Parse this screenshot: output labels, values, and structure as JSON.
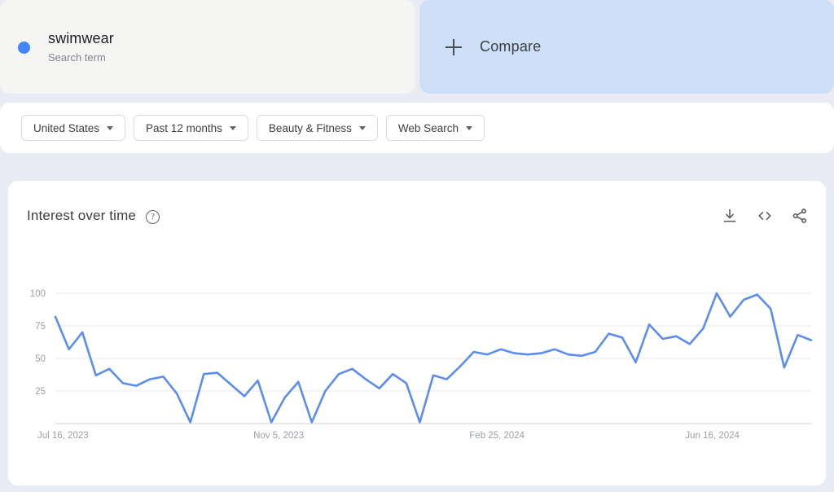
{
  "search_card": {
    "term": "swimwear",
    "subtitle": "Search term",
    "dot_color": "#4285F4"
  },
  "compare_card": {
    "label": "Compare",
    "icon": "plus-icon",
    "bg_color": "#CEDFF8"
  },
  "filters": [
    {
      "label": "United States",
      "icon": "chevron-down-icon"
    },
    {
      "label": "Past 12 months",
      "icon": "chevron-down-icon"
    },
    {
      "label": "Beauty & Fitness",
      "icon": "chevron-down-icon"
    },
    {
      "label": "Web Search",
      "icon": "chevron-down-icon"
    }
  ],
  "chart_panel": {
    "title": "Interest over time",
    "help_icon": "help-circle-icon",
    "help_glyph": "?",
    "actions": [
      {
        "name": "download-icon",
        "label": "Download"
      },
      {
        "name": "embed-code-icon",
        "label": "Embed"
      },
      {
        "name": "share-icon",
        "label": "Share"
      }
    ]
  },
  "chart_data": {
    "type": "line",
    "title": "Interest over time",
    "xlabel": "",
    "ylabel": "",
    "ylim": [
      0,
      100
    ],
    "yticks": [
      25,
      50,
      75,
      100
    ],
    "grid": true,
    "legend": "none",
    "line_color": "#5B8DEF",
    "xtick_labels": [
      "Jul 16, 2023",
      "Nov 5, 2023",
      "Feb 25, 2024",
      "Jun 16, 2024"
    ],
    "xtick_indices": [
      0,
      16,
      32,
      48
    ],
    "x": [
      "Jul 16, 2023",
      "Jul 23, 2023",
      "Jul 30, 2023",
      "Aug 6, 2023",
      "Aug 13, 2023",
      "Aug 20, 2023",
      "Aug 27, 2023",
      "Sep 3, 2023",
      "Sep 10, 2023",
      "Sep 17, 2023",
      "Sep 24, 2023",
      "Oct 1, 2023",
      "Oct 8, 2023",
      "Oct 15, 2023",
      "Oct 22, 2023",
      "Oct 29, 2023",
      "Nov 5, 2023",
      "Nov 12, 2023",
      "Nov 19, 2023",
      "Nov 26, 2023",
      "Dec 3, 2023",
      "Dec 10, 2023",
      "Dec 17, 2023",
      "Dec 24, 2023",
      "Dec 31, 2023",
      "Jan 7, 2024",
      "Jan 14, 2024",
      "Jan 21, 2024",
      "Jan 28, 2024",
      "Feb 4, 2024",
      "Feb 11, 2024",
      "Feb 18, 2024",
      "Feb 25, 2024",
      "Mar 3, 2024",
      "Mar 10, 2024",
      "Mar 17, 2024",
      "Mar 24, 2024",
      "Mar 31, 2024",
      "Apr 7, 2024",
      "Apr 14, 2024",
      "Apr 21, 2024",
      "Apr 28, 2024",
      "May 5, 2024",
      "May 12, 2024",
      "May 19, 2024",
      "May 26, 2024",
      "Jun 2, 2024",
      "Jun 9, 2024",
      "Jun 16, 2024",
      "Jun 23, 2024",
      "Jun 30, 2024",
      "Jul 7, 2024"
    ],
    "series": [
      {
        "name": "swimwear",
        "color": "#5B8DEF",
        "values": [
          82,
          57,
          70,
          37,
          42,
          31,
          29,
          34,
          36,
          23,
          1,
          38,
          39,
          30,
          21,
          33,
          1,
          20,
          32,
          1,
          25,
          38,
          42,
          34,
          27,
          38,
          31,
          1,
          37,
          34,
          44,
          55,
          53,
          57,
          54,
          53,
          54,
          57,
          53,
          52,
          55,
          69,
          66,
          47,
          76,
          65,
          67,
          61,
          73,
          100,
          82,
          95,
          99,
          88,
          43,
          68,
          64
        ]
      }
    ]
  }
}
